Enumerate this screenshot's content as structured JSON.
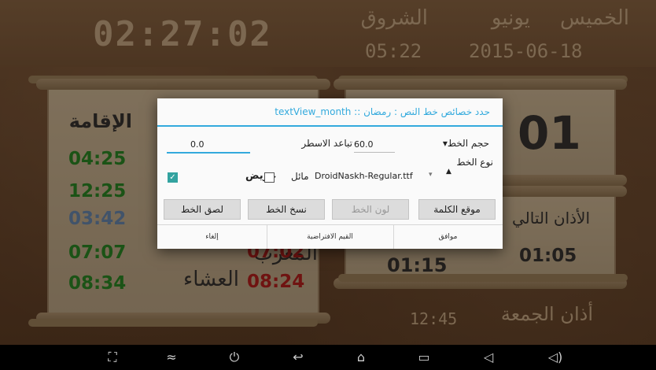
{
  "top": {
    "clock": "02:27:02",
    "day_label": "الخميس",
    "month_label": "يونيو",
    "date": "2015-06-18",
    "sunrise_label": "الشروق",
    "sunrise_time": "05:22"
  },
  "left_scroll": {
    "heading": "الإقامة",
    "times": [
      "04:25",
      "12:25",
      "03:42",
      "07:07",
      "08:34"
    ],
    "maghrib_label": "المغرب",
    "maghrib_time": "07:02",
    "isha_label": "العشاء",
    "isha_time": "08:24"
  },
  "right_scroll": {
    "day_number": "01",
    "next_adhan_label": "الأذان التالي",
    "next_adhan_time": "01:05",
    "countdown": "01:15"
  },
  "bottom": {
    "friday_label": "أذان الجمعة",
    "friday_time": "12:45"
  },
  "dialog": {
    "title": "حدد خصائص خط النص : رمضان :: textView_month",
    "font_size_label": "حجم الخط▾",
    "font_size_value": "60.0",
    "line_spacing_label": "تباعد الاسطر",
    "line_spacing_value": "0.0",
    "font_type_label": "نوع الخط",
    "font_type_value": "DroidNaskh-Regular.ttf",
    "italic_label": "مائل",
    "bold_label": "عريض",
    "buttons": {
      "word_position": "موقع الكلمة",
      "font_color": "لون الخط",
      "copy_font": "نسخ الخط",
      "paste_font": "لصق الخط"
    },
    "footer": {
      "ok": "موافق",
      "defaults": "القيم الافتراضية",
      "cancel": "إلغاء"
    }
  },
  "navbar": {
    "icons": [
      "screenshot-icon",
      "collapse-icon",
      "power-icon",
      "back-icon",
      "home-icon",
      "recents-icon",
      "volume-down-icon",
      "volume-up-icon"
    ]
  }
}
